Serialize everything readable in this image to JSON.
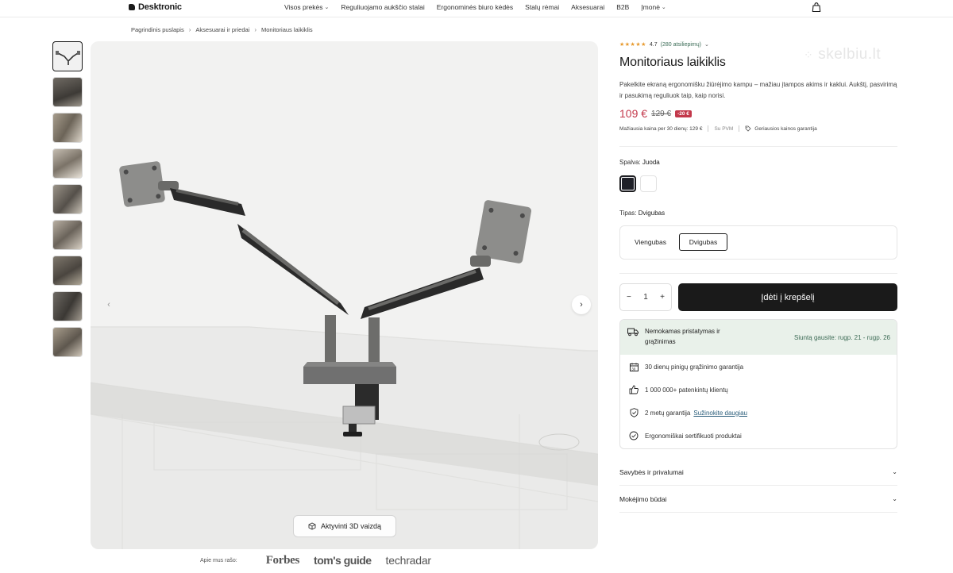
{
  "header": {
    "logo": "Desktronic",
    "nav": [
      {
        "label": "Visos prekės",
        "has_dropdown": true
      },
      {
        "label": "Reguliuojamo aukščio stalai",
        "has_dropdown": false
      },
      {
        "label": "Ergonominės biuro kėdės",
        "has_dropdown": false
      },
      {
        "label": "Stalų rėmai",
        "has_dropdown": false
      },
      {
        "label": "Aksesuarai",
        "has_dropdown": false
      },
      {
        "label": "B2B",
        "has_dropdown": false
      },
      {
        "label": "Įmonė",
        "has_dropdown": true
      }
    ],
    "cart_icon": "shopping-bag-icon"
  },
  "breadcrumb": [
    "Pagrindinis puslapis",
    "Aksesuarai ir priedai",
    "Monitoriaus laikiklis"
  ],
  "gallery": {
    "thumbnail_count": 9,
    "active_index": 0,
    "btn_3d": "Aktyvinti 3D vaizdą",
    "prev_icon": "chevron-left-icon",
    "next_icon": "chevron-right-icon"
  },
  "press": {
    "label": "Apie mus rašo:",
    "logos": [
      "Forbes",
      "tom's guide",
      "techradar"
    ]
  },
  "watermark": "skelbiu.lt",
  "product": {
    "rating": "4.7",
    "stars": "★★★★★",
    "reviews": "(280 atsiliepimų)",
    "title": "Monitoriaus laikiklis",
    "description": "Pakelkite ekraną ergonomišku žiūrėjimo kampu – mažiau įtampos akims ir kaklui. Aukštį, pasvirimą ir pasukimą reguliuok taip, kaip norisi.",
    "price": "109 €",
    "old_price": "129 €",
    "discount": "-20 €",
    "lowest_price_note": "Mažiausia kaina per 30 dienų: 129 €",
    "vat": "Su PVM",
    "best_price_guarantee": "Geriausios kainos garantija",
    "accent_color": "#c3384b"
  },
  "options": {
    "color_label": "Spalva:",
    "color_value": "Juoda",
    "swatches": [
      {
        "name": "Juoda",
        "hex": "#1f2028",
        "selected": true
      },
      {
        "name": "Balta",
        "hex": "#ffffff",
        "selected": false
      }
    ],
    "type_label": "Tipas:",
    "type_value": "Dvigubas",
    "types": [
      {
        "label": "Viengubas",
        "selected": false
      },
      {
        "label": "Dvigubas",
        "selected": true
      }
    ]
  },
  "purchase": {
    "qty_minus": "−",
    "qty_value": "1",
    "qty_plus": "+",
    "add_to_cart": "Įdėti į krepšelį"
  },
  "info": {
    "shipping_text": "Nemokamas pristatymas ir grąžinimas",
    "shipping_date": "Siuntą gausite: rugp. 21 - rugp. 26",
    "rows": [
      {
        "icon": "calendar-icon",
        "text": "30 dienų pinigų grąžinimo garantija"
      },
      {
        "icon": "thumbs-up-icon",
        "text": "1 000 000+ patenkintų klientų"
      },
      {
        "icon": "shield-check-icon",
        "text": "2 metų garantija",
        "link": "Sužinokite daugiau"
      },
      {
        "icon": "badge-check-icon",
        "text": "Ergonomiškai sertifikuoti produktai"
      }
    ]
  },
  "accordions": [
    "Savybės ir privalumai",
    "Mokėjimo būdai"
  ]
}
